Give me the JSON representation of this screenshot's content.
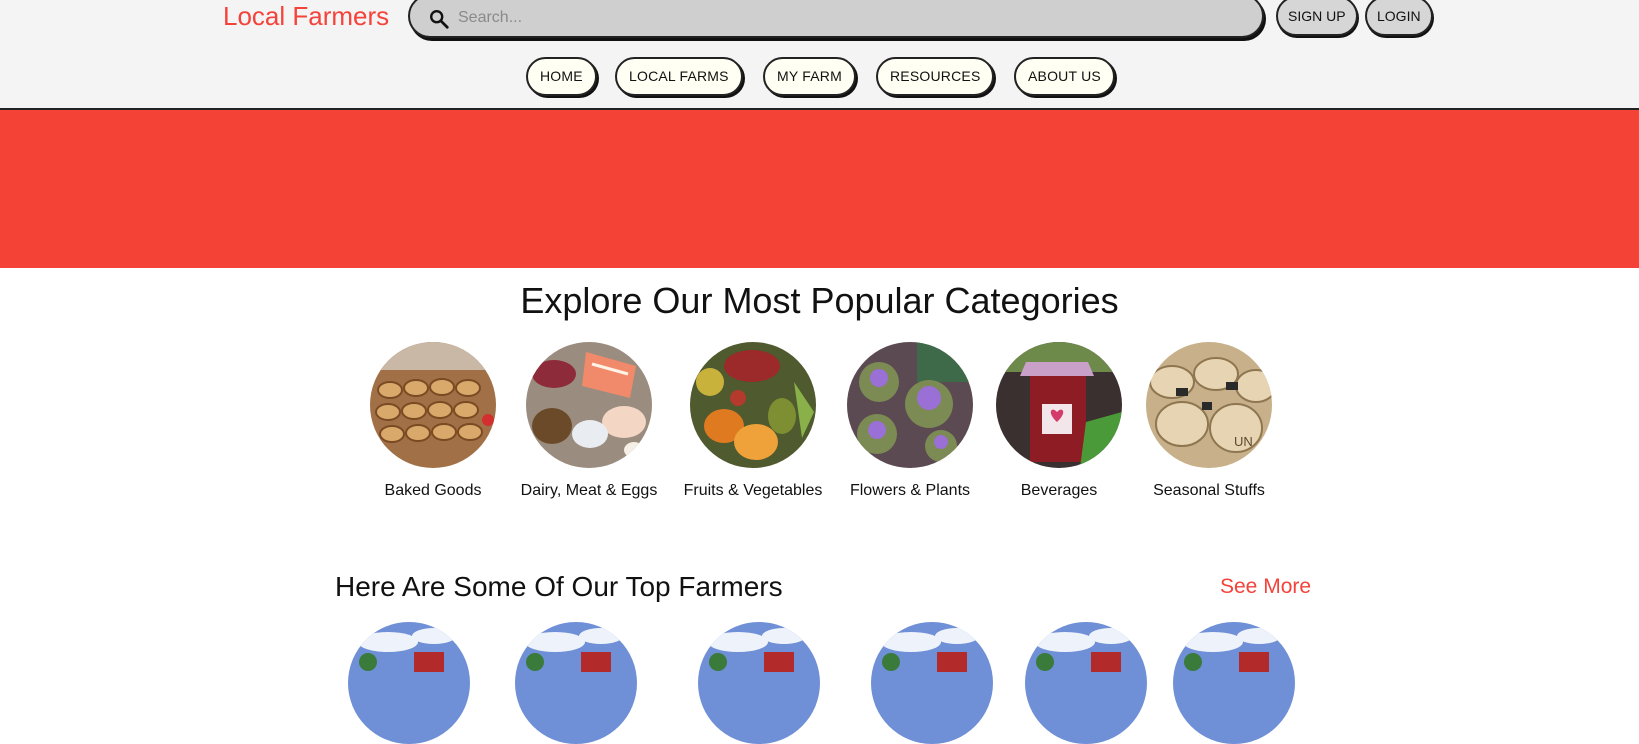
{
  "header": {
    "brand": "Local Farmers",
    "search_placeholder": "Search...",
    "sign_up": "SIGN UP",
    "login": "LOGIN"
  },
  "nav": {
    "items": [
      {
        "label": "HOME"
      },
      {
        "label": "LOCAL FARMS"
      },
      {
        "label": "MY FARM"
      },
      {
        "label": "RESOURCES"
      },
      {
        "label": "ABOUT US"
      }
    ]
  },
  "colors": {
    "accent": "#f44336",
    "brand": "#f4433a",
    "nav_bg": "#fffff4"
  },
  "categories": {
    "title": "Explore Our Most Popular Categories",
    "items": [
      {
        "label": "Baked Goods",
        "image": "baked-goods-photo"
      },
      {
        "label": "Dairy, Meat & Eggs",
        "image": "dairy-meat-eggs-photo"
      },
      {
        "label": "Fruits & Vegetables",
        "image": "fruits-vegetables-photo"
      },
      {
        "label": "Flowers & Plants",
        "image": "flowers-plants-photo"
      },
      {
        "label": "Beverages",
        "image": "beverages-photo"
      },
      {
        "label": "Seasonal Stuffs",
        "image": "seasonal-stuffs-photo"
      }
    ]
  },
  "farmers": {
    "title": "Here Are Some Of Our Top Farmers",
    "see_more": "See More",
    "count_visible": 6,
    "image": "barn-photo"
  }
}
